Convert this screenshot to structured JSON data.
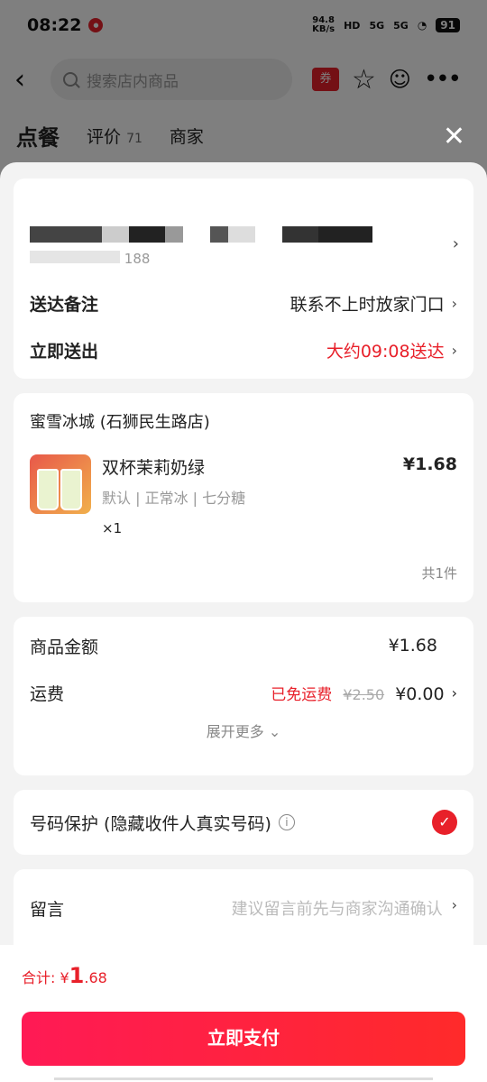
{
  "status_bar": {
    "time": "08:22",
    "speed_value": "94.8",
    "speed_unit": "KB/s",
    "network_1": "HD",
    "network_2": "5G",
    "network_3": "5G",
    "battery": "91"
  },
  "header": {
    "search_placeholder": "搜索店内商品",
    "coupon_label": "券"
  },
  "tabs": {
    "order": "点餐",
    "reviews": "评价",
    "reviews_count": "71",
    "merchant": "商家"
  },
  "address": {
    "partial_phone": "188",
    "delivery_note_label": "送达备注",
    "delivery_note_value": "联系不上时放家门口",
    "delivery_time_label": "立即送出",
    "delivery_time_value": "大约09:08送达"
  },
  "order": {
    "shop_name": "蜜雪冰城 (石狮民生路店)",
    "items": [
      {
        "name": "双杯茉莉奶绿",
        "spec": "默认 | 正常冰 | 七分糖",
        "qty": "×1",
        "price": "¥1.68"
      }
    ],
    "total_count": "共1件"
  },
  "fees": {
    "goods_label": "商品金额",
    "goods_value": "¥1.68",
    "shipping_label": "运费",
    "shipping_free": "已免运费",
    "shipping_original": "¥2.50",
    "shipping_value": "¥0.00",
    "expand": "展开更多"
  },
  "privacy": {
    "label": "号码保护 (隐藏收件人真实号码)",
    "checked": true
  },
  "message": {
    "label": "留言",
    "placeholder": "建议留言前先与商家沟通确认"
  },
  "footer": {
    "total_prefix": "合计: ¥",
    "total_int": "1",
    "total_dec": ".68",
    "pay_button": "立即支付"
  },
  "colors": {
    "accent": "#e8202a",
    "pay_gradient_start": "#ff1a55",
    "pay_gradient_end": "#ff2a2a"
  }
}
